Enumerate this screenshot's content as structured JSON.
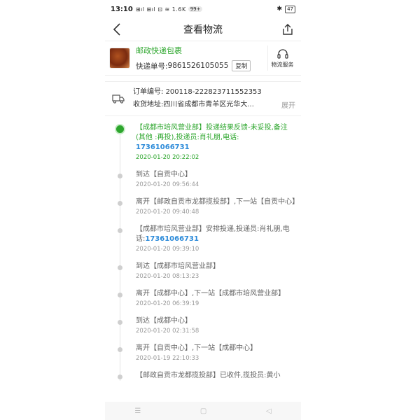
{
  "status_bar": {
    "time": "13:10",
    "signal_text": "⊞ıl ⊞ıl ⊡ ≋ 1.6K",
    "notif_badge": "99+",
    "battery": "47"
  },
  "nav": {
    "title": "查看物流"
  },
  "package": {
    "carrier": "邮政快递包裹",
    "tracking_label": "快递单号: ",
    "tracking_number": "9861526105055",
    "copy_label": "复制",
    "service_label": "物流服务"
  },
  "order": {
    "order_label": "订单编号: ",
    "order_number": "200118-222823711552353",
    "address_label": "收货地址: ",
    "address": "四川省成都市青羊区光华大...",
    "expand_label": "展开"
  },
  "events": [
    {
      "text": "【成都市培风营业部】投递结果反馈-未妥投,备注(其他 :再投),投递员:肖礼朋,电话:",
      "phone": "17361066731",
      "time": "2020-01-20 20:22:02"
    },
    {
      "text": "到达【自贡中心】",
      "phone": "",
      "time": "2020-01-20 09:56:44"
    },
    {
      "text": "离开【邮政自贡市龙都揽投部】,下一站【自贡中心】",
      "phone": "",
      "time": "2020-01-20 09:40:48"
    },
    {
      "text": "【成都市培风营业部】安排投递,投递员:肖礼朋,电话:",
      "phone": "17361066731",
      "time": "2020-01-20 09:39:10"
    },
    {
      "text": "到达【成都市培风营业部】",
      "phone": "",
      "time": "2020-01-20 08:13:23"
    },
    {
      "text": "离开【成都中心】,下一站【成都市培风营业部】",
      "phone": "",
      "time": "2020-01-20 06:39:19"
    },
    {
      "text": "到达【成都中心】",
      "phone": "",
      "time": "2020-01-20 02:31:58"
    },
    {
      "text": "离开【自贡中心】,下一站【成都中心】",
      "phone": "",
      "time": "2020-01-19 22:10:33"
    },
    {
      "text": "【邮政自贡市龙都揽投部】已收件,揽投员:黄小",
      "phone": "",
      "time": ""
    }
  ],
  "bottom_nav": {
    "menu_glyph": "☰",
    "home_glyph": "▢",
    "back_glyph": "◁"
  },
  "colors": {
    "accent_green": "#2da62d",
    "phone_blue": "#2b8ad9"
  }
}
